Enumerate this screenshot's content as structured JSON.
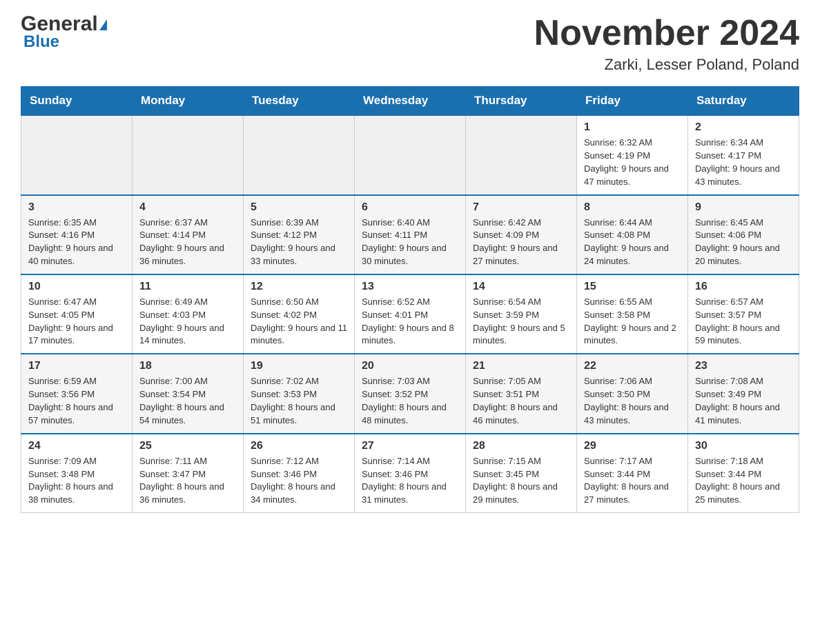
{
  "header": {
    "logo_general": "General",
    "logo_blue": "Blue",
    "month_title": "November 2024",
    "location": "Zarki, Lesser Poland, Poland"
  },
  "days_of_week": [
    "Sunday",
    "Monday",
    "Tuesday",
    "Wednesday",
    "Thursday",
    "Friday",
    "Saturday"
  ],
  "weeks": [
    {
      "days": [
        {
          "number": "",
          "info": ""
        },
        {
          "number": "",
          "info": ""
        },
        {
          "number": "",
          "info": ""
        },
        {
          "number": "",
          "info": ""
        },
        {
          "number": "",
          "info": ""
        },
        {
          "number": "1",
          "info": "Sunrise: 6:32 AM\nSunset: 4:19 PM\nDaylight: 9 hours and 47 minutes."
        },
        {
          "number": "2",
          "info": "Sunrise: 6:34 AM\nSunset: 4:17 PM\nDaylight: 9 hours and 43 minutes."
        }
      ]
    },
    {
      "days": [
        {
          "number": "3",
          "info": "Sunrise: 6:35 AM\nSunset: 4:16 PM\nDaylight: 9 hours and 40 minutes."
        },
        {
          "number": "4",
          "info": "Sunrise: 6:37 AM\nSunset: 4:14 PM\nDaylight: 9 hours and 36 minutes."
        },
        {
          "number": "5",
          "info": "Sunrise: 6:39 AM\nSunset: 4:12 PM\nDaylight: 9 hours and 33 minutes."
        },
        {
          "number": "6",
          "info": "Sunrise: 6:40 AM\nSunset: 4:11 PM\nDaylight: 9 hours and 30 minutes."
        },
        {
          "number": "7",
          "info": "Sunrise: 6:42 AM\nSunset: 4:09 PM\nDaylight: 9 hours and 27 minutes."
        },
        {
          "number": "8",
          "info": "Sunrise: 6:44 AM\nSunset: 4:08 PM\nDaylight: 9 hours and 24 minutes."
        },
        {
          "number": "9",
          "info": "Sunrise: 6:45 AM\nSunset: 4:06 PM\nDaylight: 9 hours and 20 minutes."
        }
      ]
    },
    {
      "days": [
        {
          "number": "10",
          "info": "Sunrise: 6:47 AM\nSunset: 4:05 PM\nDaylight: 9 hours and 17 minutes."
        },
        {
          "number": "11",
          "info": "Sunrise: 6:49 AM\nSunset: 4:03 PM\nDaylight: 9 hours and 14 minutes."
        },
        {
          "number": "12",
          "info": "Sunrise: 6:50 AM\nSunset: 4:02 PM\nDaylight: 9 hours and 11 minutes."
        },
        {
          "number": "13",
          "info": "Sunrise: 6:52 AM\nSunset: 4:01 PM\nDaylight: 9 hours and 8 minutes."
        },
        {
          "number": "14",
          "info": "Sunrise: 6:54 AM\nSunset: 3:59 PM\nDaylight: 9 hours and 5 minutes."
        },
        {
          "number": "15",
          "info": "Sunrise: 6:55 AM\nSunset: 3:58 PM\nDaylight: 9 hours and 2 minutes."
        },
        {
          "number": "16",
          "info": "Sunrise: 6:57 AM\nSunset: 3:57 PM\nDaylight: 8 hours and 59 minutes."
        }
      ]
    },
    {
      "days": [
        {
          "number": "17",
          "info": "Sunrise: 6:59 AM\nSunset: 3:56 PM\nDaylight: 8 hours and 57 minutes."
        },
        {
          "number": "18",
          "info": "Sunrise: 7:00 AM\nSunset: 3:54 PM\nDaylight: 8 hours and 54 minutes."
        },
        {
          "number": "19",
          "info": "Sunrise: 7:02 AM\nSunset: 3:53 PM\nDaylight: 8 hours and 51 minutes."
        },
        {
          "number": "20",
          "info": "Sunrise: 7:03 AM\nSunset: 3:52 PM\nDaylight: 8 hours and 48 minutes."
        },
        {
          "number": "21",
          "info": "Sunrise: 7:05 AM\nSunset: 3:51 PM\nDaylight: 8 hours and 46 minutes."
        },
        {
          "number": "22",
          "info": "Sunrise: 7:06 AM\nSunset: 3:50 PM\nDaylight: 8 hours and 43 minutes."
        },
        {
          "number": "23",
          "info": "Sunrise: 7:08 AM\nSunset: 3:49 PM\nDaylight: 8 hours and 41 minutes."
        }
      ]
    },
    {
      "days": [
        {
          "number": "24",
          "info": "Sunrise: 7:09 AM\nSunset: 3:48 PM\nDaylight: 8 hours and 38 minutes."
        },
        {
          "number": "25",
          "info": "Sunrise: 7:11 AM\nSunset: 3:47 PM\nDaylight: 8 hours and 36 minutes."
        },
        {
          "number": "26",
          "info": "Sunrise: 7:12 AM\nSunset: 3:46 PM\nDaylight: 8 hours and 34 minutes."
        },
        {
          "number": "27",
          "info": "Sunrise: 7:14 AM\nSunset: 3:46 PM\nDaylight: 8 hours and 31 minutes."
        },
        {
          "number": "28",
          "info": "Sunrise: 7:15 AM\nSunset: 3:45 PM\nDaylight: 8 hours and 29 minutes."
        },
        {
          "number": "29",
          "info": "Sunrise: 7:17 AM\nSunset: 3:44 PM\nDaylight: 8 hours and 27 minutes."
        },
        {
          "number": "30",
          "info": "Sunrise: 7:18 AM\nSunset: 3:44 PM\nDaylight: 8 hours and 25 minutes."
        }
      ]
    }
  ]
}
